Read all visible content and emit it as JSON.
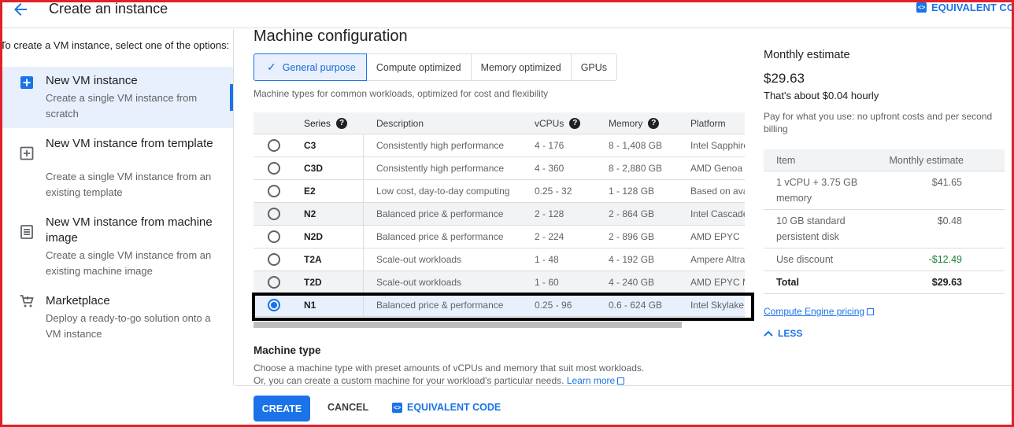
{
  "header": {
    "title": "Create an instance",
    "equivalent_code": "EQUIVALENT CODE"
  },
  "left": {
    "intro": "To create a VM instance, select one of the options:",
    "options": [
      {
        "title": "New VM instance",
        "desc": "Create a single VM instance from scratch",
        "icon": "add-box-icon",
        "selected": true
      },
      {
        "title": "New VM instance from template",
        "desc": "Create a single VM instance from an existing template",
        "icon": "template-icon",
        "selected": false
      },
      {
        "title": "New VM instance from machine image",
        "desc": "Create a single VM instance from an existing machine image",
        "icon": "machine-image-icon",
        "selected": false
      },
      {
        "title": "Marketplace",
        "desc": "Deploy a ready-to-go solution onto a VM instance",
        "icon": "cart-icon",
        "selected": false
      }
    ]
  },
  "machine": {
    "section_title": "Machine configuration",
    "tabs": [
      "General purpose",
      "Compute optimized",
      "Memory optimized",
      "GPUs"
    ],
    "active_tab": "General purpose",
    "tabs_desc": "Machine types for common workloads, optimized for cost and flexibility",
    "columns": [
      "Series",
      "Description",
      "vCPUs",
      "Memory",
      "Platform"
    ],
    "rows": [
      {
        "series": "C3",
        "desc": "Consistently high performance",
        "vcpus": "4 - 176",
        "memory": "8 - 1,408 GB",
        "platform": "Intel Sapphire"
      },
      {
        "series": "C3D",
        "desc": "Consistently high performance",
        "vcpus": "4 - 360",
        "memory": "8 - 2,880 GB",
        "platform": "AMD Genoa"
      },
      {
        "series": "E2",
        "desc": "Low cost, day-to-day computing",
        "vcpus": "0.25 - 32",
        "memory": "1 - 128 GB",
        "platform": "Based on ava"
      },
      {
        "series": "N2",
        "desc": "Balanced price & performance",
        "vcpus": "2 - 128",
        "memory": "2 - 864 GB",
        "platform": "Intel Cascade"
      },
      {
        "series": "N2D",
        "desc": "Balanced price & performance",
        "vcpus": "2 - 224",
        "memory": "2 - 896 GB",
        "platform": "AMD EPYC"
      },
      {
        "series": "T2A",
        "desc": "Scale-out workloads",
        "vcpus": "1 - 48",
        "memory": "4 - 192 GB",
        "platform": "Ampere Altra"
      },
      {
        "series": "T2D",
        "desc": "Scale-out workloads",
        "vcpus": "1 - 60",
        "memory": "4 - 240 GB",
        "platform": "AMD EPYC M"
      },
      {
        "series": "N1",
        "desc": "Balanced price & performance",
        "vcpus": "0.25 - 96",
        "memory": "0.6 - 624 GB",
        "platform": "Intel Skylake"
      }
    ],
    "selected_series": "N1",
    "machine_type_title": "Machine type",
    "machine_type_desc1": "Choose a machine type with preset amounts of vCPUs and memory that suit most workloads.",
    "machine_type_desc2": "Or, you can create a custom machine for your workload's particular needs.",
    "learn_more": "Learn more"
  },
  "estimate": {
    "title": "Monthly estimate",
    "price": "$29.63",
    "hourly": "That's about $0.04 hourly",
    "note": "Pay for what you use: no upfront costs and per second billing",
    "columns": [
      "Item",
      "Monthly estimate"
    ],
    "rows": [
      {
        "item": "1 vCPU + 3.75 GB memory",
        "cost": "$41.65"
      },
      {
        "item": "10 GB standard persistent disk",
        "cost": "$0.48"
      },
      {
        "item": "Use discount",
        "cost": "-$12.49"
      },
      {
        "item": "Total",
        "cost": "$29.63"
      }
    ],
    "pricing_link": "Compute Engine pricing",
    "less": "LESS"
  },
  "footer": {
    "create": "CREATE",
    "cancel": "CANCEL",
    "equivalent_code": "EQUIVALENT CODE"
  },
  "colors": {
    "accent": "#1a73e8",
    "frame": "#e2202a",
    "discount": "#188038"
  }
}
